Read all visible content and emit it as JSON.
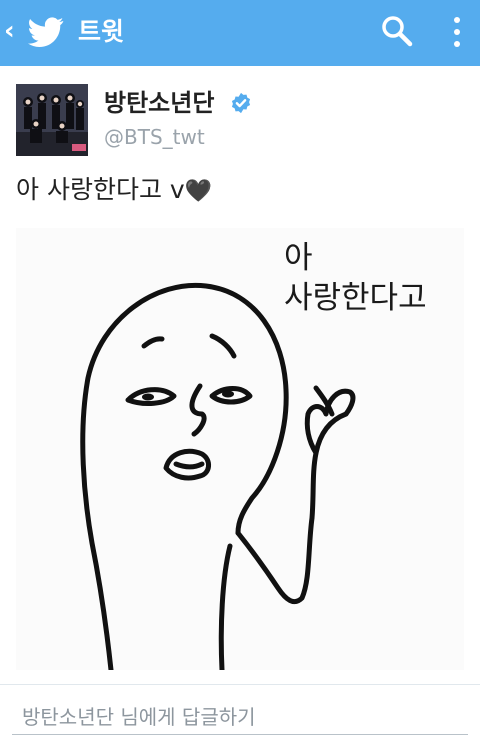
{
  "header": {
    "title": "트윗",
    "back_icon": "chevron-left-icon",
    "logo_icon": "twitter-bird-icon",
    "search_icon": "search-icon",
    "more_icon": "more-vertical-icon",
    "background_color": "#55acee"
  },
  "tweet": {
    "author_name": "방탄소년단",
    "verified": true,
    "verified_color": "#55acee",
    "handle": "@BTS_twt",
    "text": "아 사랑한다고 v",
    "text_emoji": "🖤",
    "media": {
      "sticker_text_line1": "아",
      "sticker_text_line2": "사랑한다고"
    }
  },
  "reply": {
    "placeholder": "방탄소년단 님에게 답글하기"
  }
}
